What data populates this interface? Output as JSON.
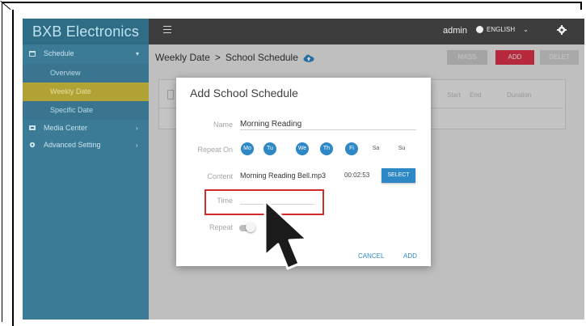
{
  "app": {
    "brand": "BXB Electronics",
    "header": {
      "user": "admin",
      "language": "ENGLISH",
      "language_caret": "⌄"
    },
    "sidebar": {
      "sections": [
        {
          "label": "Schedule",
          "chevron": "▾"
        },
        {
          "label": "Media Center",
          "chevron": "›"
        },
        {
          "label": "Advanced Setting",
          "chevron": "›"
        }
      ],
      "schedule_items": [
        "Overview",
        "Weekly Date",
        "Specific Date"
      ],
      "active_item": "Weekly Date"
    },
    "breadcrumb": {
      "part1": "Weekly Date",
      "separator": ">",
      "part2": "School Schedule"
    },
    "toolbar": {
      "mass_label": "MASS",
      "add_label": "ADD",
      "delete_label": "DELET"
    },
    "table": {
      "headers": [
        "Start",
        "End",
        "Duration"
      ]
    }
  },
  "dialog": {
    "title": "Add School Schedule",
    "name_label": "Name",
    "name_value": "Morning Reading",
    "repeat_on_label": "Repeat On",
    "days": [
      {
        "label": "Mo",
        "selected": true
      },
      {
        "label": "Tu",
        "selected": true
      },
      {
        "label": "We",
        "selected": true
      },
      {
        "label": "Th",
        "selected": true
      },
      {
        "label": "Fi",
        "selected": true
      },
      {
        "label": "Sa",
        "selected": false
      },
      {
        "label": "Su",
        "selected": false
      }
    ],
    "content_label": "Content",
    "content_file": "Morning Reading Bell.mp3",
    "content_duration": "00:02:53",
    "select_label": "SELECT",
    "time_label": "Time",
    "time_value": "",
    "repeat_label": "Repeat",
    "repeat_on": false,
    "cancel_label": "CANCEL",
    "add_label": "ADD"
  },
  "colors": {
    "accent_blue": "#2e88c6",
    "sidebar": "#3c7b95",
    "active_item": "#b0a234",
    "highlight_red": "#d12b2b",
    "topbar": "#3d3d3d",
    "add_button": "#e0334a"
  },
  "icons": [
    "calendar-icon",
    "media-icon",
    "settings-icon",
    "menu-icon",
    "globe-icon",
    "gear-icon",
    "cloud-upload-icon",
    "mouse-cursor-icon"
  ]
}
